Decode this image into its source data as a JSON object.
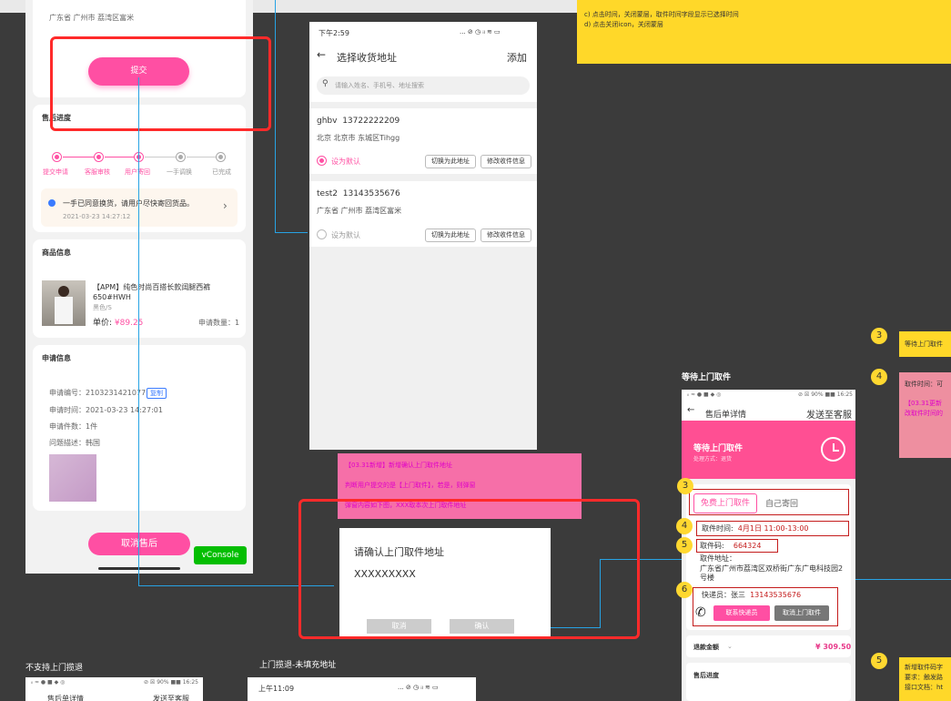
{
  "left_phone": {
    "address": "广东省 广州市 荔湾区富米",
    "submit": "提交",
    "progress_title": "售后进度",
    "steps": [
      "提交申请",
      "客服审核",
      "用户寄回",
      "一手调换",
      "已完成"
    ],
    "notice_text": "一手已同意换货，请用户尽快寄回货品。",
    "notice_time": "2021-03-23 14:27:12",
    "goods_title": "商品信息",
    "goods_name": "【APM】纯色时尚百搭长款阔腿西裤 650#HWH",
    "goods_spec": "黑色/S",
    "price_label": "单价: ",
    "price": "¥89.25",
    "qty": "申请数量：1",
    "apply_title": "申请信息",
    "apply_no_label": "申请编号：",
    "apply_no": "2103231421077",
    "copy": "复制",
    "apply_time": "申请时间：2021-03-23 14:27:01",
    "apply_count": "申请件数：1件",
    "problem": "问题描述：韩国",
    "cancel": "取消售后",
    "vconsole": "vConsole"
  },
  "address_phone": {
    "time": "下午2:59",
    "status": "... ⊘ ◷ ᵢₗ ≋ ▭",
    "back": "←",
    "title": "选择收货地址",
    "add": "添加",
    "search_placeholder": "请输入姓名、手机号、地址搜索",
    "items": [
      {
        "name": "ghbv",
        "phone": "13722222209",
        "addr": "北京  北京市  东城区Tihgg",
        "default": "设为默认",
        "switch": "切换为此地址",
        "edit": "修改收件信息"
      },
      {
        "name": "test2",
        "phone": "13143535676",
        "addr": "广东省  广州市  荔湾区富米",
        "default": "设为默认",
        "switch": "切换为此地址",
        "edit": "修改收件信息"
      }
    ]
  },
  "top_note": {
    "line1": "c) 点击时间，关闭蒙层，取件时间字段显示已选择时间",
    "line2": "d) 点击关闭icon，关闭蒙层"
  },
  "pink_note": {
    "line1": "【03.31新增】新增确认上门取件地址",
    "line2": "判断用户提交的是【上门取件】，若是，则弹窗",
    "line3": "弹窗内容如下图，XXX取本次上门取件地址"
  },
  "dialog": {
    "title": "请确认上门取件地址",
    "content": "XXXXXXXXX",
    "cancel": "取消",
    "confirm": "确认"
  },
  "pickup": {
    "label": "等待上门取件",
    "status_left": "ᵢₗ ≈ ● ■ ◆ ◎",
    "status_right": "⊘ ☒ 90% ■■ 16:25",
    "back": "←",
    "title": "售后单详情",
    "send": "发送至客服",
    "banner_title": "等待上门取件",
    "banner_sub": "处理方式：退货",
    "tab1": "免费上门取件",
    "tab2": "自己寄回",
    "pick_time_label": "取件时间:",
    "pick_time": "4月1日  11:00-13:00",
    "code_label": "取件码:",
    "code": "664324",
    "addr_label": "取件地址：",
    "addr": "广东省广州市荔湾区双桥街广东广电科技园2号楼",
    "courier_label": "快递员：张三",
    "courier_phone": "13143535676",
    "contact": "联系快递员",
    "cancel_pick": "取消上门取件",
    "refund_label": "退款金额",
    "refund": "¥ 309.50",
    "progress": "售后进度"
  },
  "badges": {
    "n3": "3",
    "n4": "4",
    "n5": "5",
    "n6": "6"
  },
  "right_notes": {
    "r3": "等待上门取件",
    "r4a": "取件时间：可",
    "r4b": "【03.31更新",
    "r4c": "改取件时间的",
    "r5a": "新增取件码字",
    "r5b": "要求：触发路",
    "r5c": "接口文档：ht"
  },
  "bottom_labels": {
    "a": "不支持上门揽退",
    "b": "上门揽退-未填充地址"
  },
  "bottom_phone_a": {
    "status_left": "ᵢₗ ≈ ● ■ ◆ ◎",
    "status_right": "⊘ ☒ 90% ■■ 16:25",
    "title": "售后单详情",
    "send": "发送至客服"
  },
  "bottom_phone_b": {
    "time": "上午11:09",
    "status": "... ⊘ ◷ ᵢₗ ≋ ▭"
  }
}
